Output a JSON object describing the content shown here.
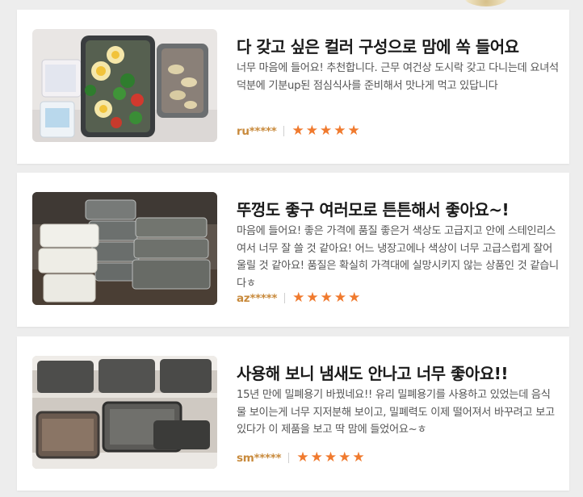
{
  "reviews": [
    {
      "title": "다 갖고 싶은 컬러 구성으로 맘에 쏙 들어요",
      "body": "너무 마음에 들어요! 추천합니다. 근무 여건상 도시락 갖고 다니는데 요녀석 덕분에 기분up된 점심식사를 준비해서 맛나게 먹고 있답니다",
      "user": "ru*****",
      "rating": 5,
      "photo_icon": "lunch-container-photo"
    },
    {
      "title": "뚜껑도 좋구 여러모로 튼튼해서 좋아요~!",
      "body": "마음에 들어요! 좋은 가격에 품질 좋은거 색상도 고급지고 안에 스테인리스여서 너무 잘 쓸 것 같아요! 어느 냉장고에나 색상이 너무 고급스럽게 잘어울릴 것 같아요! 품질은 확실히 가격대에 실망시키지 않는 상품인 것 같습니다ㅎ",
      "user": "az*****",
      "rating": 5,
      "photo_icon": "stacked-containers-photo"
    },
    {
      "title": "사용해 보니 냄새도 안나고 너무 좋아요!!",
      "body": "15년 만에 밀폐용기 바꿨네요!! 유리 밀폐용기를 사용하고 있었는데 음식물 보이는게 너무 지저분해 보이고, 밀폐력도 이제 떨어져서 바꾸려고 보고 있다가 이 제품을 보고 딱 맘에 들었어요~ㅎ",
      "user": "sm*****",
      "rating": 5,
      "photo_icon": "fridge-containers-photo"
    }
  ],
  "colors": {
    "star": "#f07a2e",
    "username": "#c88a3c",
    "background": "#ededed"
  }
}
